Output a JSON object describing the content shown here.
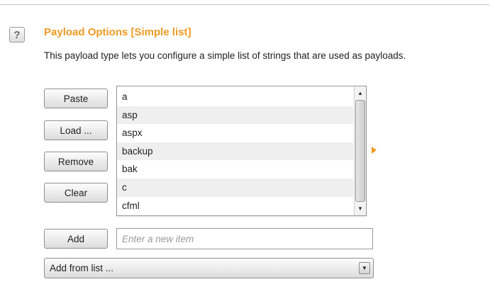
{
  "section": {
    "help_icon": "?",
    "title": "Payload Options [Simple list]",
    "description": "This payload type lets you configure a simple list of strings that are used as payloads."
  },
  "buttons": {
    "paste": "Paste",
    "load": "Load ...",
    "remove": "Remove",
    "clear": "Clear",
    "add": "Add"
  },
  "list": {
    "items": [
      "a",
      "asp",
      "aspx",
      "backup",
      "bak",
      "c",
      "cfml"
    ]
  },
  "new_item": {
    "value": "",
    "placeholder": "Enter a new item"
  },
  "add_from_list": {
    "selected": "Add from list ..."
  },
  "icons": {
    "scroll_up": "▲",
    "scroll_down": "▼",
    "dropdown_arrow": "▼"
  },
  "colors": {
    "accent": "#f09a22",
    "alt_row": "#efefef"
  }
}
